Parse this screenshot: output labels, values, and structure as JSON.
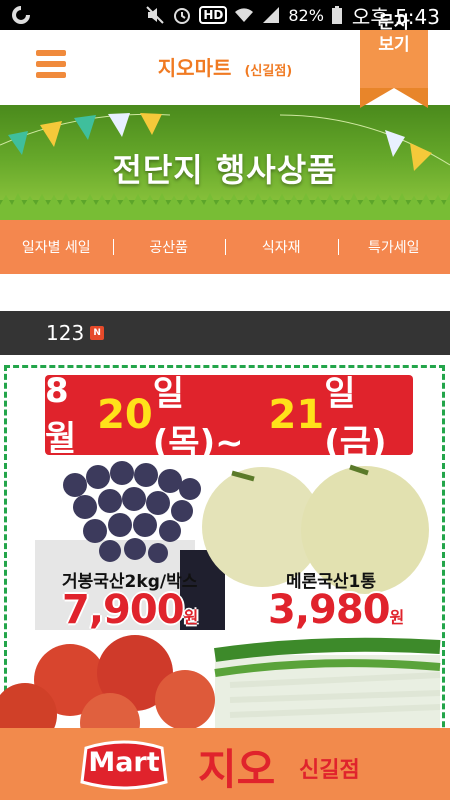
{
  "status_bar": {
    "battery": "82%",
    "clock": "오후 5:43",
    "hd_label": "HD",
    "icons": [
      "app-icon",
      "mute-icon",
      "alarm-icon",
      "wifi-icon",
      "signal-icon",
      "battery-icon"
    ]
  },
  "header": {
    "title": "지오마트",
    "subtitle": "(신길점)",
    "menu_icon": "hamburger-icon",
    "sms_button": "문자\n보기",
    "accent_color": "#f07a22"
  },
  "banner": {
    "title": "전단지 행사상품"
  },
  "category_nav": {
    "items": [
      "일자별 세일",
      "공산품",
      "식자재",
      "특가세일"
    ],
    "background": "#f4874e"
  },
  "post": {
    "title": "123",
    "new_badge": "N"
  },
  "flyer": {
    "date_prefix": "8월",
    "date_day1": "20",
    "date_mid": "일(목)~",
    "date_day2": "21",
    "date_suffix": "일(금)",
    "items": [
      {
        "label": "거봉국산2kg/박스",
        "price": "7,900",
        "unit": "원"
      },
      {
        "label": "메론국산1통",
        "price": "3,980",
        "unit": "원"
      }
    ]
  },
  "bottom_bar": {
    "logo_text": "Mart",
    "brand": "지오",
    "branch": "신길점"
  }
}
